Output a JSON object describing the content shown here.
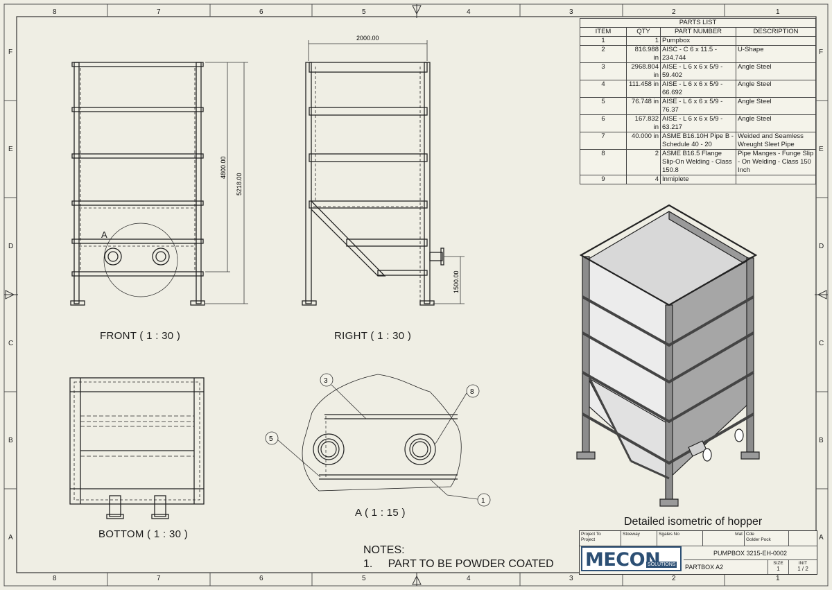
{
  "zones": {
    "top": [
      "8",
      "7",
      "6",
      "5",
      "4",
      "3",
      "2",
      "1"
    ],
    "side": [
      "F",
      "E",
      "D",
      "C",
      "B",
      "A"
    ]
  },
  "views": {
    "front": "FRONT ( 1 : 30 )",
    "right": "RIGHT ( 1 : 30 )",
    "bottom": "BOTTOM ( 1 : 30 )",
    "detail": "A ( 1 : 15 )",
    "detail_marker": "A",
    "isometric": "Detailed isometric of hopper"
  },
  "dimensions": {
    "width": "2000.00",
    "height_inner": "4800.00",
    "height_total": "5218.00",
    "pipe_height": "1500.00"
  },
  "balloons": [
    "3",
    "8",
    "5",
    "1"
  ],
  "parts_list": {
    "title": "PARTS LIST",
    "headers": [
      "ITEM",
      "QTY",
      "PART NUMBER",
      "DESCRIPTION"
    ],
    "rows": [
      [
        "1",
        "1",
        "Pumpbox",
        ""
      ],
      [
        "2",
        "816.988 in",
        "AISC - C 6 x 11.5 - 234.744",
        "U-Shape"
      ],
      [
        "3",
        "2968.804 in",
        "AISE - L 6 x 6 x 5/9 - 59.402",
        "Angle Steel"
      ],
      [
        "4",
        "111.458 in",
        "AISE - L 6 x 6 x 5/9 - 66.692",
        "Angle Steel"
      ],
      [
        "5",
        "76.748 in",
        "AISE - L 6 x 6 x 5/9 - 76.37",
        "Angle Steel"
      ],
      [
        "6",
        "167.832 in",
        "AISE - L 6 x 6 x 5/9 - 63.217",
        "Angle Steel"
      ],
      [
        "7",
        "40.000 in",
        "ASME B16.10H Pipe B - Schedule 40 - 20",
        "Weided and Seamless Wreught Sleet Pipe"
      ],
      [
        "8",
        "2",
        "ASME B16.5 Flange Slip-On Welding - Class 150.8",
        "Pipe Manges - Funge Slip - On Welding - Class 150 Inch"
      ],
      [
        "9",
        "4",
        "Inmiplete",
        ""
      ]
    ]
  },
  "notes": {
    "title": "NOTES:",
    "item_num": "1.",
    "item_text": "PART TO BE POWDER COATED"
  },
  "title_block": {
    "project_to": "Project To",
    "project": "Project",
    "drawn": "Stoeway",
    "scales": "Sgales No",
    "mat": "Mat",
    "cde": "Cde",
    "golder": "Golder Pock",
    "logo_main": "MECON",
    "logo_sub": "SOLUTIONS",
    "drawing_no": "PUMPBOX 3215-EH-0002",
    "part_name": "PARTBOX A2",
    "size_label": "SIZE",
    "size_value": "1",
    "sheet_label": "INIT",
    "sheet_value": "1 / 2"
  }
}
